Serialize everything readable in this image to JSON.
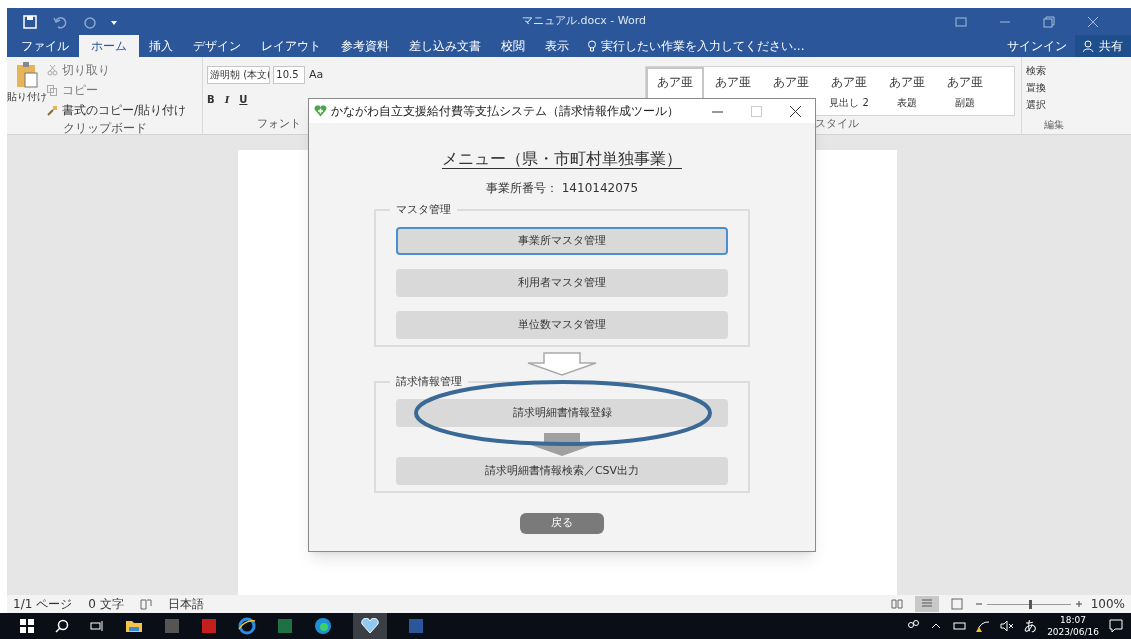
{
  "window": {
    "title": "マニュアル.docx - Word"
  },
  "ribbon_tabs": [
    {
      "label": "ファイル",
      "selected": false
    },
    {
      "label": "ホーム",
      "selected": true
    },
    {
      "label": "挿入",
      "selected": false
    },
    {
      "label": "デザイン",
      "selected": false
    },
    {
      "label": "レイアウト",
      "selected": false
    },
    {
      "label": "参考資料",
      "selected": false
    },
    {
      "label": "差し込み文書",
      "selected": false
    },
    {
      "label": "校閲",
      "selected": false
    },
    {
      "label": "表示",
      "selected": false
    }
  ],
  "tell_me": "実行したい作業を入力してください...",
  "sign_in": "サインイン",
  "share": "共有",
  "clipboard": {
    "paste": "貼り付け",
    "cut": "切り取り",
    "copy": "コピー",
    "format_painter": "書式のコピー/貼り付け",
    "label": "クリップボード"
  },
  "font": {
    "name": "游明朝 (本文(",
    "size": "10.5",
    "case": "Aa",
    "bold": "B",
    "italic": "I",
    "underline": "U",
    "label": "フォント"
  },
  "styles": {
    "label": "スタイル",
    "items": [
      {
        "sample": "あア亜",
        "selected": true
      },
      {
        "sample": "あア亜",
        "selected": false
      },
      {
        "sample": "あア亜",
        "selected": false
      },
      {
        "sample": "あア亜",
        "label": "見出し 2",
        "selected": false
      },
      {
        "sample": "あア亜",
        "label": "表題",
        "selected": false
      },
      {
        "sample": "あア亜",
        "label": "副題",
        "selected": false
      }
    ]
  },
  "editing": {
    "label": "編集",
    "items": [
      "検索",
      "置換",
      "選択"
    ]
  },
  "status_bar": {
    "page": "1/1 ページ",
    "words": "0 文字",
    "language": "日本語",
    "zoom": "100%",
    "zoom_level": {
      "level": 0.5
    }
  },
  "taskbar": {
    "ime": "あ",
    "time": "18:07",
    "date": "2023/06/16"
  },
  "dialog": {
    "title": "かながわ自立支援給付費等支払システム（請求情報作成ツール）",
    "heading": "メニュー（県・市町村単独事業）",
    "office_number": "事業所番号： 1410142075",
    "groups": [
      {
        "label": "マスタ管理",
        "kind": "hollow",
        "buttons": [
          {
            "label": "事業所マスタ管理",
            "focused": true
          },
          {
            "label": "利用者マスタ管理",
            "focused": false
          },
          {
            "label": "単位数マスタ管理",
            "focused": false
          }
        ]
      },
      {
        "label": "請求情報管理",
        "kind": "filled",
        "buttons": [
          {
            "label": "請求明細書情報登録",
            "focused": false,
            "circled": true
          },
          {
            "label": "請求明細書情報検索／CSV出力",
            "focused": false,
            "circled": false
          }
        ]
      }
    ],
    "back": "戻る"
  }
}
